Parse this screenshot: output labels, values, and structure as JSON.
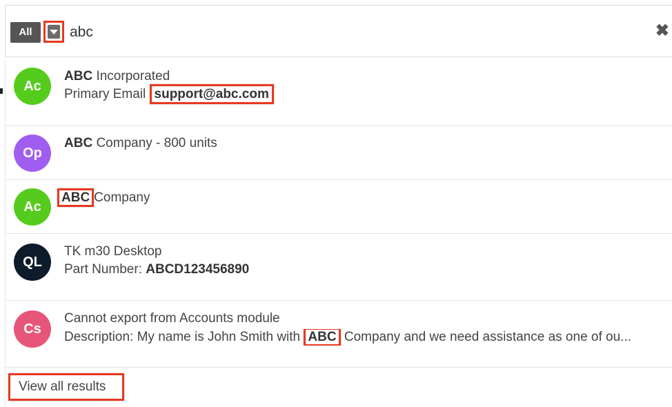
{
  "search": {
    "scope_label": "All",
    "query": "abc",
    "clear_glyph": "✖"
  },
  "results": [
    {
      "avatar_initials": "Ac",
      "avatar_color": "#55cc1d",
      "title_match": "ABC",
      "title_rest": " Incorporated",
      "sub_prefix": "Primary Email ",
      "sub_match": "support@abc.com",
      "sub_suffix": ""
    },
    {
      "avatar_initials": "Op",
      "avatar_color": "#a05ef0",
      "title_match": "ABC",
      "title_rest": " Company - 800 units"
    },
    {
      "avatar_initials": "Ac",
      "avatar_color": "#55cc1d",
      "title_match": "ABC",
      "title_rest": "Company"
    },
    {
      "avatar_initials": "QL",
      "avatar_color": "#0d1b2a",
      "title": "TK m30 Desktop",
      "sub_prefix": "Part Number: ",
      "sub_match": "ABCD123456890"
    },
    {
      "avatar_initials": "Cs",
      "avatar_color": "#e8557a",
      "title": "Cannot export from Accounts module",
      "sub_prefix": "Description: My name is John Smith with ",
      "sub_match": "ABC",
      "sub_suffix": " Company and we need assistance as one of ou..."
    }
  ],
  "footer": {
    "view_all_label": "View all results"
  },
  "colors": {
    "highlight_border": "#e8381f"
  }
}
